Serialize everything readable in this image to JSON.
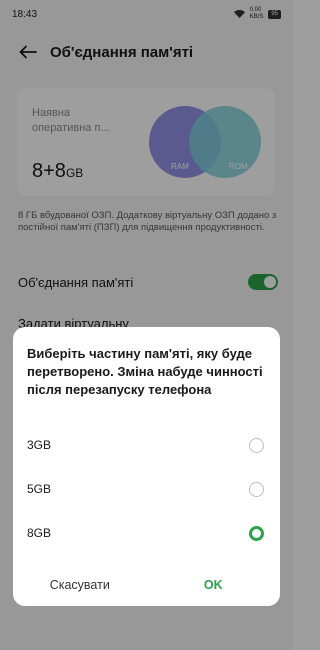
{
  "status_bar": {
    "time": "18:43",
    "speed_value": "0.00",
    "speed_unit": "KB/S",
    "battery": "95"
  },
  "header": {
    "title": "Об'єднання пам'яті"
  },
  "memory_card": {
    "label": "Наявна оперативна п...",
    "value": "8+8",
    "unit": "GB",
    "ram_label": "RAM",
    "rom_label": "ROM",
    "ram_color": "#7f7fe3",
    "rom_color": "#7fd0dc"
  },
  "description": "8 ГБ вбудованої ОЗП. Додаткову віртуальну ОЗП додано з постійної пам'яті (ПЗП) для підвищення продуктивності.",
  "settings": {
    "merge_label": "Об'єднання пам'яті",
    "merge_enabled": true,
    "virtual_label": "Задати віртуальну"
  },
  "dialog": {
    "title": "Виберіть частину пам'яті, яку буде перетворено. Зміна набуде чинності після перезапуску телефона",
    "options": [
      {
        "label": "3GB",
        "checked": false
      },
      {
        "label": "5GB",
        "checked": false
      },
      {
        "label": "8GB",
        "checked": true
      }
    ],
    "cancel_label": "Скасувати",
    "ok_label": "OK"
  },
  "colors": {
    "accent": "#2aa34a"
  }
}
